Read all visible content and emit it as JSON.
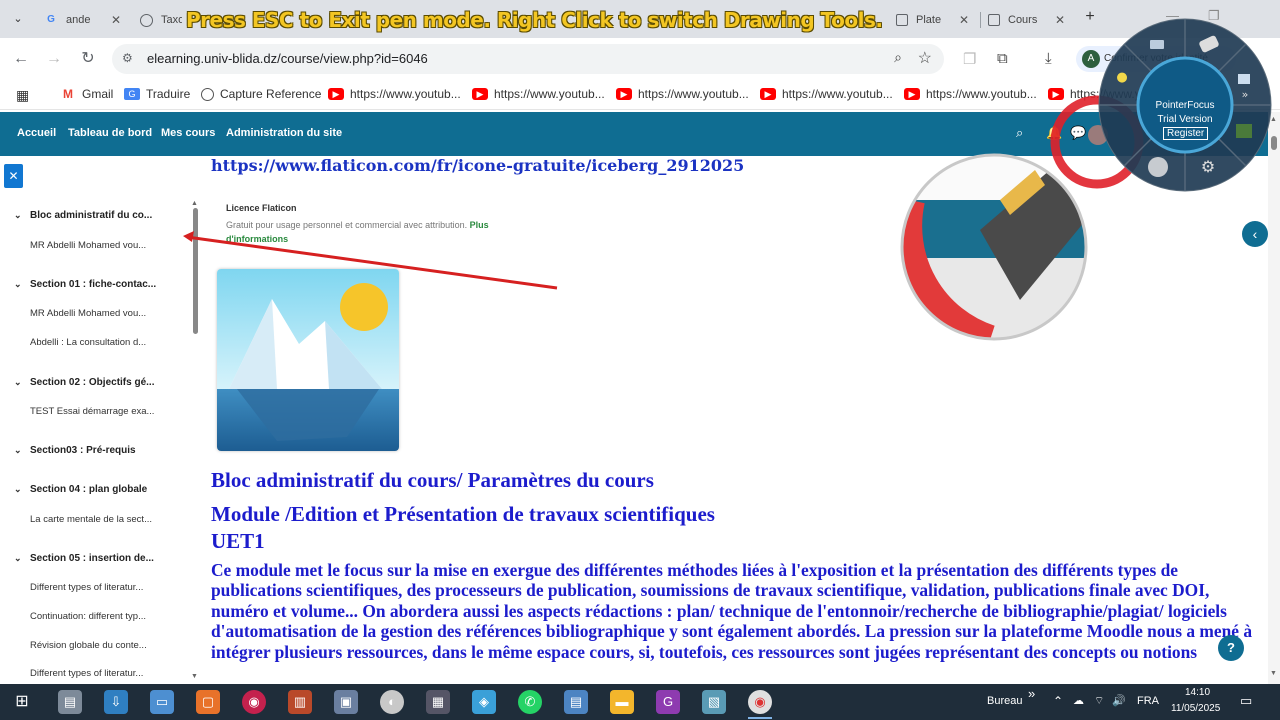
{
  "browser": {
    "tabs": [
      {
        "title": "ande",
        "icon": "G",
        "icon_color": "#4285f4"
      },
      {
        "title": "Taxo",
        "icon": "🌐",
        "icon_color": "#5f6368"
      },
      {
        "title": "Plate",
        "icon": "▣",
        "icon_color": "#5f6368"
      },
      {
        "title": "Cours",
        "icon": "▣",
        "icon_color": "#5f6368"
      }
    ],
    "pen_mode_banner": "Press ESC to Exit pen mode.  Right Click to switch Drawing Tools.",
    "url": "elearning.univ-blida.dz/course/view.php?id=6046",
    "profile_text": "Confirmer votre identité",
    "bookmarks": [
      {
        "label": "Gmail",
        "icon": "gmail-icon"
      },
      {
        "label": "Traduire",
        "icon": "translate-icon"
      },
      {
        "label": "Capture Reference",
        "icon": "capture-icon"
      },
      {
        "label": "https://www.youtub...",
        "icon": "youtube-icon"
      },
      {
        "label": "https://www.youtub...",
        "icon": "youtube-icon"
      },
      {
        "label": "https://www.youtub...",
        "icon": "youtube-icon"
      },
      {
        "label": "https://www.youtub...",
        "icon": "youtube-icon"
      },
      {
        "label": "https://www.youtub...",
        "icon": "youtube-icon"
      },
      {
        "label": "https://www.youtub...",
        "icon": "youtube-icon"
      }
    ]
  },
  "moodle": {
    "nav": [
      "Accueil",
      "Tableau de bord",
      "Mes cours",
      "Administration du site"
    ],
    "course_index": {
      "sections": [
        {
          "title": "Bloc administratif du co...",
          "items": [
            "MR Abdelli Mohamed vou..."
          ]
        },
        {
          "title": "Section 01 : fiche-contac...",
          "items": [
            "MR Abdelli Mohamed vou...",
            "Abdelli : La consultation d..."
          ]
        },
        {
          "title": "Section 02 : Objectifs gé...",
          "items": [
            "TEST Essai démarrage exa..."
          ]
        },
        {
          "title": "Section03 : Pré-requis",
          "items": []
        },
        {
          "title": "Section 04 : plan globale",
          "items": [
            "La carte mentale de la sect..."
          ]
        },
        {
          "title": "Section 05 : insertion de...",
          "items": [
            "Different types of literatur...",
            "Continuation: different typ...",
            "Révision globale du conte...",
            "Different types of literatur..."
          ]
        }
      ]
    },
    "content": {
      "link_url": "https://www.flaticon.com/fr/icone-gratuite/iceberg_2912025",
      "licence_title": "Licence Flaticon",
      "licence_text": "Gratuit pour usage personnel et commercial avec attribution.",
      "licence_more": "Plus d'informations",
      "heading1": "Bloc administratif du cours/ Paramètres du cours",
      "heading2": "Module /Edition et Présentation de travaux scientifiques",
      "heading3": "UET1",
      "paragraph": "Ce module met le focus sur la mise en exergue des différentes méthodes liées à l'exposition et la présentation des différents types de publications scientifiques,  des processeurs de publication, soumissions de travaux scientifique, validation, publications finale avec DOI, numéro et volume... On abordera aussi les aspects rédactions : plan/ technique de l'entonnoir/recherche de bibliographie/plagiat/ logiciels d'automatisation de la gestion des références bibliographique y sont également abordés. La  pression sur la plateforme Moodle nous a mené à intégrer plusieurs ressources, dans le même espace cours, si, toutefois,  ces ressources sont jugées représentant des concepts ou notions"
    }
  },
  "pointerfocus": {
    "title": "PointerFocus",
    "subtitle": "Trial Version",
    "register": "Register"
  },
  "taskbar": {
    "desktop_label": "Bureau",
    "chevron": "»",
    "language": "FRA",
    "time": "14:10",
    "date": "11/05/2025"
  },
  "colors": {
    "moodle_nav": "#0f6d92",
    "heading_blue": "#1c1ccc",
    "link_blue": "#1b33c2",
    "pen_red": "#d62020",
    "banner_yellow": "#f3c623"
  }
}
